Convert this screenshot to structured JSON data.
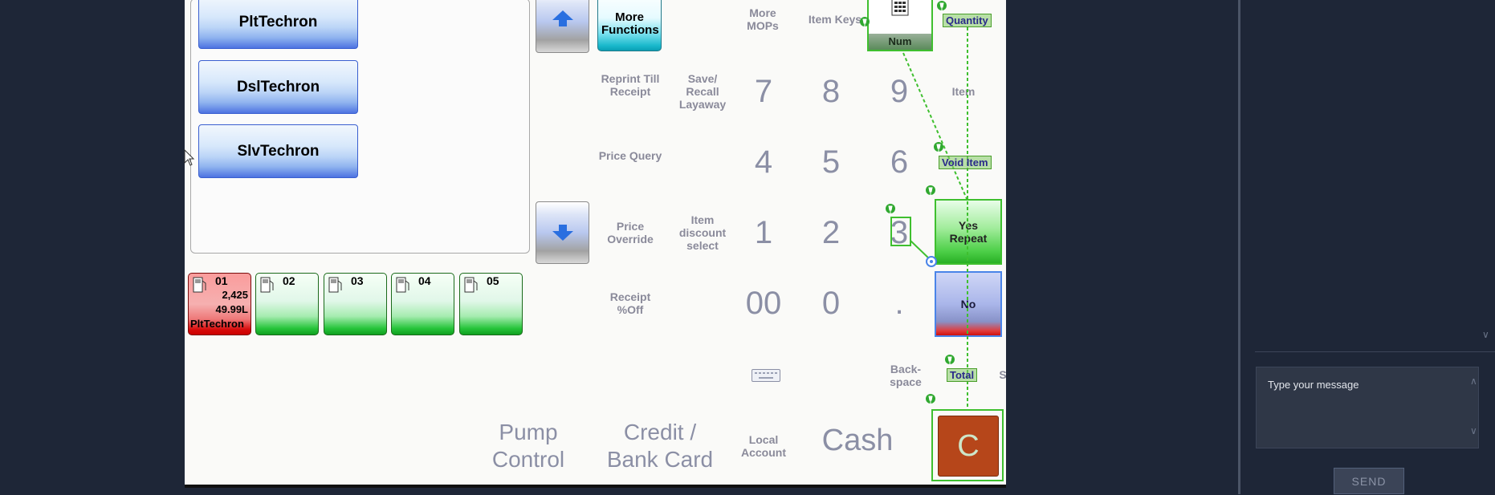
{
  "grades": [
    {
      "label": "PltTechron"
    },
    {
      "label": "DslTechron"
    },
    {
      "label": "SlvTechron"
    }
  ],
  "pumps": [
    {
      "number": "01",
      "volume_amount": "2,425",
      "liters": "49.99L",
      "grade": "PltTechron",
      "status": "active"
    },
    {
      "number": "02"
    },
    {
      "number": "03"
    },
    {
      "number": "04"
    },
    {
      "number": "05"
    }
  ],
  "functions": {
    "more_functions": "More Functions",
    "more_mops": "More MOPs",
    "item_keys": "Item Keys",
    "num": "Num",
    "quantity": "Quantity",
    "reprint": "Reprint Till Receipt",
    "save_recall": "Save/ Recall Layaway",
    "item": "Item",
    "price_query": "Price Query",
    "void_item": "Void Item",
    "price_override": "Price Override",
    "item_discount": "Item discount select",
    "yes_repeat": "Yes Repeat",
    "receipt_off": "Receipt %Off",
    "no": "No",
    "space": "Space",
    "backspace": "Back- space",
    "total": "Total",
    "pump_control": "Pump Control",
    "credit_bank": "Credit / Bank Card",
    "local_account": "Local Account",
    "cash": "Cash",
    "clear": "C"
  },
  "keypad": {
    "k7": "7",
    "k8": "8",
    "k9": "9",
    "k4": "4",
    "k5": "5",
    "k6": "6",
    "k1": "1",
    "k2": "2",
    "k3": "3",
    "k00": "00",
    "k0": "0",
    "kdot": "."
  },
  "chat": {
    "placeholder": "Type your message",
    "send": "SEND"
  },
  "colors": {
    "background": "#1e2637",
    "pos_bg": "#fafaf8",
    "key_text": "#8b8fa5",
    "overlay_green": "#3fbf2f",
    "clear_button": "#b6461a"
  }
}
